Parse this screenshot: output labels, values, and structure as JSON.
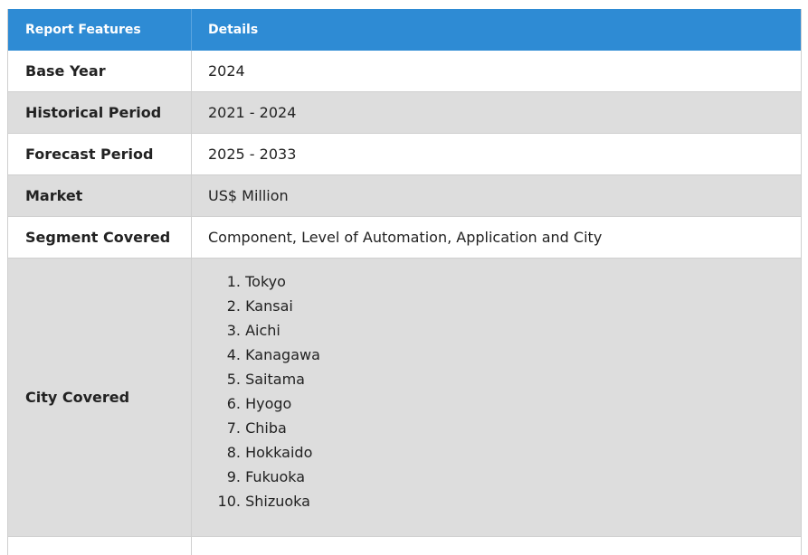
{
  "header": {
    "col1": "Report Features",
    "col2": "Details"
  },
  "rows": [
    {
      "label": "Base Year",
      "value": "2024"
    },
    {
      "label": "Historical Period",
      "value": "2021 - 2024"
    },
    {
      "label": "Forecast Period",
      "value": "2025 - 2033"
    },
    {
      "label": "Market",
      "value": "US$ Million"
    },
    {
      "label": "Segment Covered",
      "value": "Component, Level of Automation, Application and City"
    }
  ],
  "city": {
    "label": "City Covered",
    "items": [
      {
        "num": "1.",
        "name": "Tokyo"
      },
      {
        "num": "2.",
        "name": "Kansai"
      },
      {
        "num": "3.",
        "name": "Aichi"
      },
      {
        "num": "4.",
        "name": "Kanagawa"
      },
      {
        "num": "5.",
        "name": "Saitama"
      },
      {
        "num": "6.",
        "name": "Hyogo"
      },
      {
        "num": "7.",
        "name": "Chiba"
      },
      {
        "num": "8.",
        "name": "Hokkaido"
      },
      {
        "num": "9.",
        "name": "Fukuoka"
      },
      {
        "num": "10.",
        "name": "Shizuoka"
      }
    ]
  },
  "colors": {
    "header_bg": "#2e8bd4",
    "row_gray": "#dddddd",
    "row_white": "#ffffff",
    "border": "#cfcfcf"
  }
}
